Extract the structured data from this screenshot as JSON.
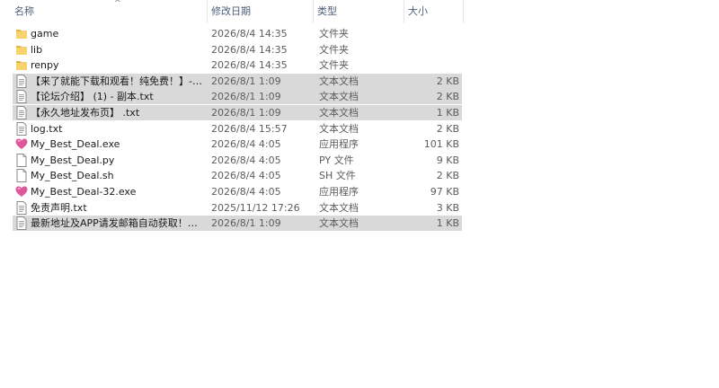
{
  "columns": {
    "name": "名称",
    "modified": "修改日期",
    "type": "类型",
    "size": "大小"
  },
  "sort_indicator": "^",
  "files": [
    {
      "icon": "folder-icon",
      "name": "game",
      "modified": "2026/8/4 14:35",
      "type": "文件夹",
      "size": "",
      "selected": false
    },
    {
      "icon": "folder-icon",
      "name": "lib",
      "modified": "2026/8/4 14:35",
      "type": "文件夹",
      "size": "",
      "selected": false
    },
    {
      "icon": "folder-icon",
      "name": "renpy",
      "modified": "2026/8/4 14:35",
      "type": "文件夹",
      "size": "",
      "selected": false
    },
    {
      "icon": "text-document-icon",
      "name": "【来了就能下载和观看！纯免费！】- 副...",
      "modified": "2026/8/1 1:09",
      "type": "文本文档",
      "size": "2 KB",
      "selected": true
    },
    {
      "icon": "text-document-icon",
      "name": "【论坛介绍】 (1) - 副本.txt",
      "modified": "2026/8/1 1:09",
      "type": "文本文档",
      "size": "2 KB",
      "selected": true
    },
    {
      "icon": "text-document-icon",
      "name": "【永久地址发布页】 .txt",
      "modified": "2026/8/1 1:09",
      "type": "文本文档",
      "size": "1 KB",
      "selected": true
    },
    {
      "icon": "text-document-icon",
      "name": "log.txt",
      "modified": "2026/8/4 15:57",
      "type": "文本文档",
      "size": "2 KB",
      "selected": false
    },
    {
      "icon": "heart-app-icon",
      "name": "My_Best_Deal.exe",
      "modified": "2026/8/4 4:05",
      "type": "应用程序",
      "size": "101 KB",
      "selected": false
    },
    {
      "icon": "blank-file-icon",
      "name": "My_Best_Deal.py",
      "modified": "2026/8/4 4:05",
      "type": "PY 文件",
      "size": "9 KB",
      "selected": false
    },
    {
      "icon": "blank-file-icon",
      "name": "My_Best_Deal.sh",
      "modified": "2026/8/4 4:05",
      "type": "SH 文件",
      "size": "2 KB",
      "selected": false
    },
    {
      "icon": "heart-app-icon",
      "name": "My_Best_Deal-32.exe",
      "modified": "2026/8/4 4:05",
      "type": "应用程序",
      "size": "97 KB",
      "selected": false
    },
    {
      "icon": "text-document-icon",
      "name": "免责声明.txt",
      "modified": "2025/11/12 17:26",
      "type": "文本文档",
      "size": "3 KB",
      "selected": false
    },
    {
      "icon": "text-document-icon",
      "name": "最新地址及APP请发邮箱自动获取！！！...",
      "modified": "2026/8/1 1:09",
      "type": "文本文档",
      "size": "1 KB",
      "selected": true
    }
  ],
  "colors": {
    "folder": "#f8d26a",
    "folder_dark": "#e0b23e",
    "selection": "#d9d9d9",
    "heart": "#e0569a",
    "header_text": "#4c607a"
  }
}
